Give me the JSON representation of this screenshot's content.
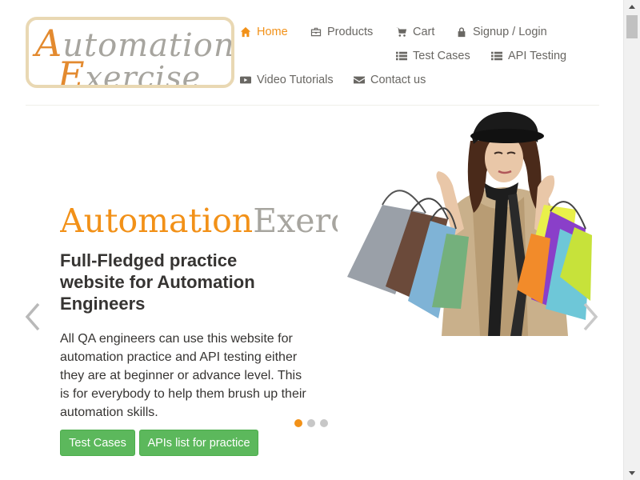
{
  "logo": {
    "line1_cap": "A",
    "line1_rest": "utomation",
    "line2_cap": "E",
    "line2_rest": "xercise"
  },
  "nav": {
    "home": "Home",
    "products": "Products",
    "cart": "Cart",
    "signup_login": "Signup / Login",
    "test_cases": "Test Cases",
    "api_testing": "API Testing",
    "video_tutorials": "Video Tutorials",
    "contact_us": "Contact us",
    "active_item": "home"
  },
  "slide": {
    "title_part1": "Automation",
    "title_part2": "Exercise",
    "heading": "Full-Fledged practice website for Automation Engineers",
    "text": "All QA engineers can use this website for automation practice and API testing either they are at beginner or advance level. This is for everybody to help them brush up their automation skills.",
    "btn_test_cases": "Test Cases",
    "btn_apis": "APIs list for practice",
    "active_dot": 0,
    "dot_count": 3
  },
  "colors": {
    "accent": "#f29118",
    "button_green": "#5cb85c",
    "text_dark": "#363432",
    "text_muted": "#696763"
  },
  "icons": [
    "home-icon",
    "briefcase-icon",
    "cart-icon",
    "lock-icon",
    "list-icon",
    "youtube-icon",
    "envelope-icon",
    "chevron-left-icon",
    "chevron-right-icon"
  ]
}
